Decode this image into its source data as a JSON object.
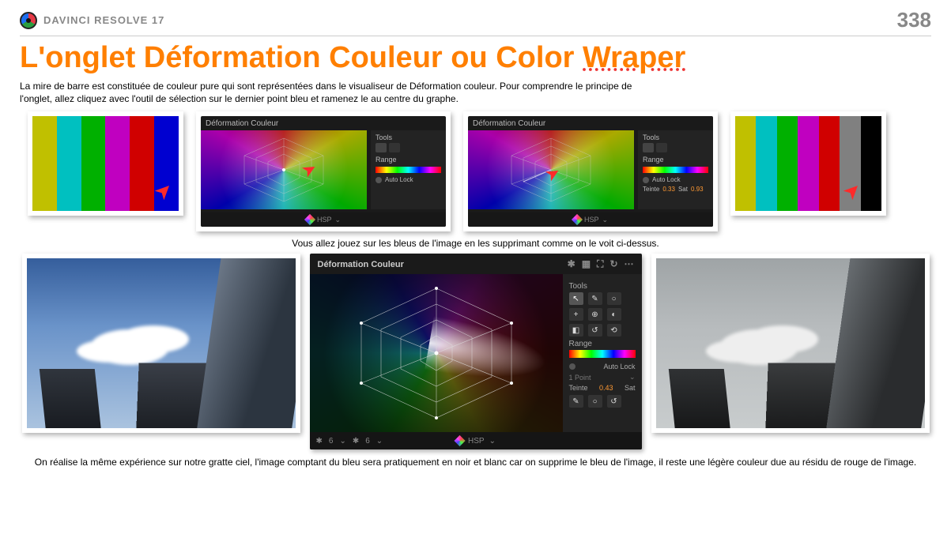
{
  "header": {
    "app_name": "DAVINCI RESOLVE 17",
    "page_number": "338"
  },
  "title": {
    "part1": "L'onglet Déformation Couleur ou Color ",
    "underlined": "Wraper"
  },
  "intro": "La mire de barre est constituée de couleur pure qui sont représentées dans le visualiseur de Déformation couleur. Pour comprendre le principe de l'onglet, allez cliquez avec l'outil de sélection sur le dernier point bleu et ramenez le au centre du graphe.",
  "panel_small": {
    "title": "Déformation Couleur",
    "tools_label": "Tools",
    "range_label": "Range",
    "autolock": "Auto Lock",
    "hsp": "HSP",
    "teinte_label": "Teinte",
    "teinte_val": "0.33",
    "sat_label": "Sat",
    "sat_val": "0.93"
  },
  "caption1": "Vous allez jouez sur les bleus de l'image en les supprimant comme on le voit ci-dessus.",
  "panel_large": {
    "title": "Déformation Couleur",
    "tools_label": "Tools",
    "range_label": "Range",
    "autolock": "Auto Lock",
    "one_point": "1 Point",
    "teinte_label": "Teinte",
    "teinte_val": "0.43",
    "sat_label": "Sat",
    "hsp": "HSP",
    "grid1": "6",
    "grid2": "6"
  },
  "caption2": "On réalise la même expérience sur notre gratte ciel, l'image comptant du bleu sera pratiquement en noir et blanc car on supprime le bleu de l'image, il reste une légère couleur due au résidu de rouge de l'image.",
  "bar_colors_a": [
    "#c0c000",
    "#00c0c0",
    "#00b000",
    "#c000c0",
    "#d00000",
    "#0000d0"
  ],
  "bar_colors_b": [
    "#c0c000",
    "#00c0c0",
    "#00b000",
    "#c000c0",
    "#d00000",
    "#808080",
    "#000000"
  ]
}
